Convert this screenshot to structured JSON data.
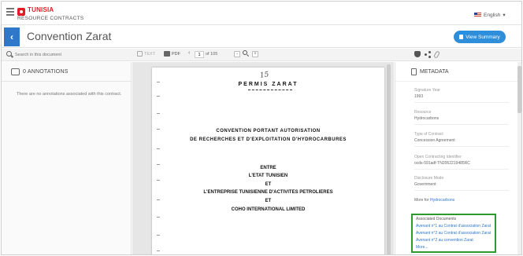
{
  "brand": {
    "country": "TUNISIA",
    "subtitle": "RESOURCE CONTRACTS"
  },
  "language": {
    "label": "English",
    "caret": "▾"
  },
  "header": {
    "back": "‹",
    "title": "Convention Zarat",
    "view_summary": "View Summary"
  },
  "toolbar": {
    "search_placeholder": "Search in this document",
    "text_label": "TEXT",
    "pdf_label": "PDF",
    "prev": "‹",
    "page_value": "1",
    "page_of": "of 105",
    "zoom_out": "-",
    "zoom_in": "+"
  },
  "annotations": {
    "title": "0 ANNOTATIONS",
    "empty": "There are no annotations associated with this contract."
  },
  "document": {
    "handwritten": "15",
    "heading": "PERMIS ZARAT",
    "line1": "CONVENTION PORTANT AUTORISATION",
    "line2": "DE RECHERCHES ET D'EXPLOITATION D'HYDROCARBURES",
    "line3": "ENTRE",
    "line4": "L'ETAT TUNISIEN",
    "line5": "ET",
    "line6": "L'ENTREPRISE TUNISIENNE D'ACTIVITES PETROLIERES",
    "line7": "ET",
    "line8": "COHO INTERNATIONAL LIMITED"
  },
  "metadata": {
    "title": "METADATA",
    "items": [
      {
        "label": "Signature Year",
        "value": "1993"
      },
      {
        "label": "Resource",
        "value": "Hydrocarbons"
      },
      {
        "label": "Type of Contract",
        "value": "Concession Agreement"
      },
      {
        "label": "Open Contracting Identifier",
        "value": "ocds-591adf-TN2062219485RC"
      },
      {
        "label": "Disclosure Mode",
        "value": "Government"
      }
    ],
    "more_for_prefix": "More for ",
    "more_for_link": "Hydrocarbons",
    "associated": {
      "title": "Associated Documents",
      "links": [
        "Avenant n°1 au Contrat d'association Zarat",
        "Avenant n°2 au Contrat d'association Zarat",
        "Avenant n°2 au convention Zarat",
        "More..."
      ]
    }
  }
}
